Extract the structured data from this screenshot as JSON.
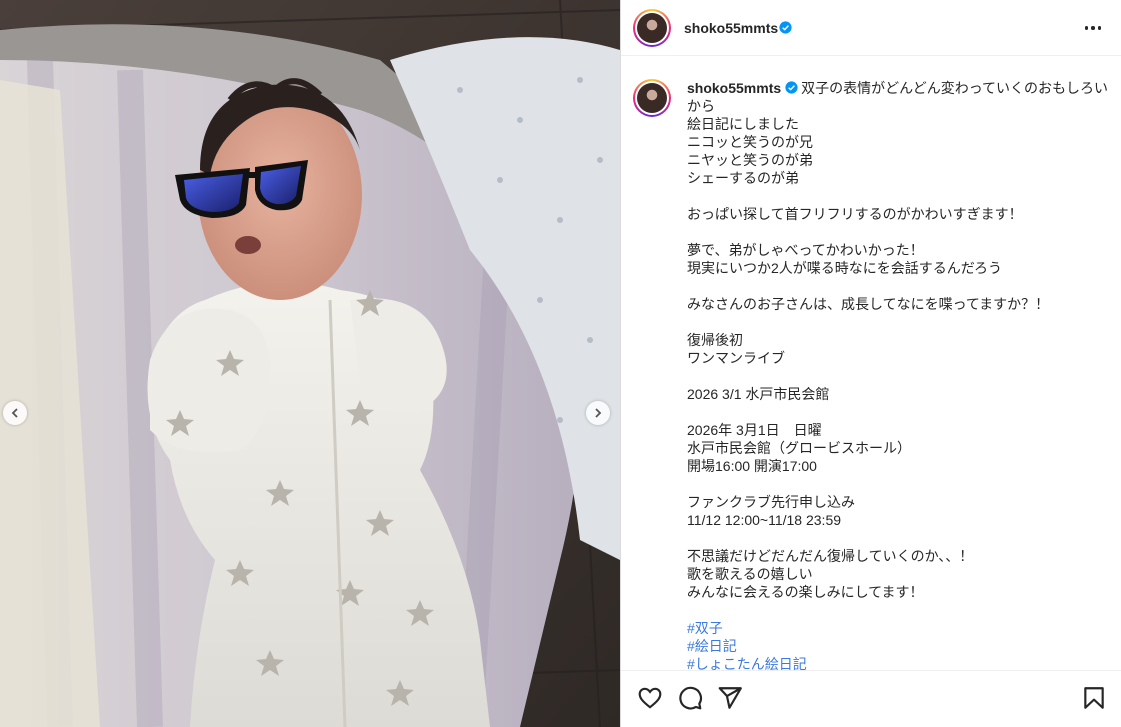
{
  "post": {
    "username": "shoko55mmts",
    "verified": true,
    "caption_lines": [
      "双子の表情がどんどん変わっていくのおもしろいから",
      "絵日記にしました",
      "ニコッと笑うのが兄",
      "ニヤッと笑うのが弟",
      "シェーするのが弟",
      "",
      "おっぱい探して首フリフリするのがかわいすぎます！",
      "",
      "夢で、弟がしゃべってかわいかった！",
      "現実にいつか2人が喋る時なにを会話するんだろう",
      "",
      "みなさんのお子さんは、成長してなにを喋ってますか？！",
      "",
      "復帰後初",
      "ワンマンライブ",
      "",
      "2026 3/1 水戸市民会館",
      "",
      "2026年 3月1日　日曜",
      "水戸市民会館（グロービスホール）",
      "開場16:00 開演17:00",
      "",
      "ファンクラブ先行申し込み",
      "11/12 12:00~11/18 23:59",
      "",
      "不思議だけどだんだん復帰していくのか、、！",
      "歌を歌えるの嬉しい",
      "みんなに会えるの楽しみにしてます！",
      ""
    ],
    "hashtags": [
      "#双子",
      "#絵日記",
      "#しょこたん絵日記"
    ]
  },
  "icons": {
    "more": "more-options-icon",
    "prev": "chevron-left-icon",
    "next": "chevron-right-icon",
    "like": "heart-icon",
    "comment": "comment-icon",
    "share": "send-icon",
    "save": "bookmark-icon",
    "verified": "verified-badge-icon"
  },
  "colors": {
    "verified": "#0095f6",
    "hashtag": "#3a7ae0",
    "text": "#262626",
    "divider": "#dbdbdb"
  }
}
